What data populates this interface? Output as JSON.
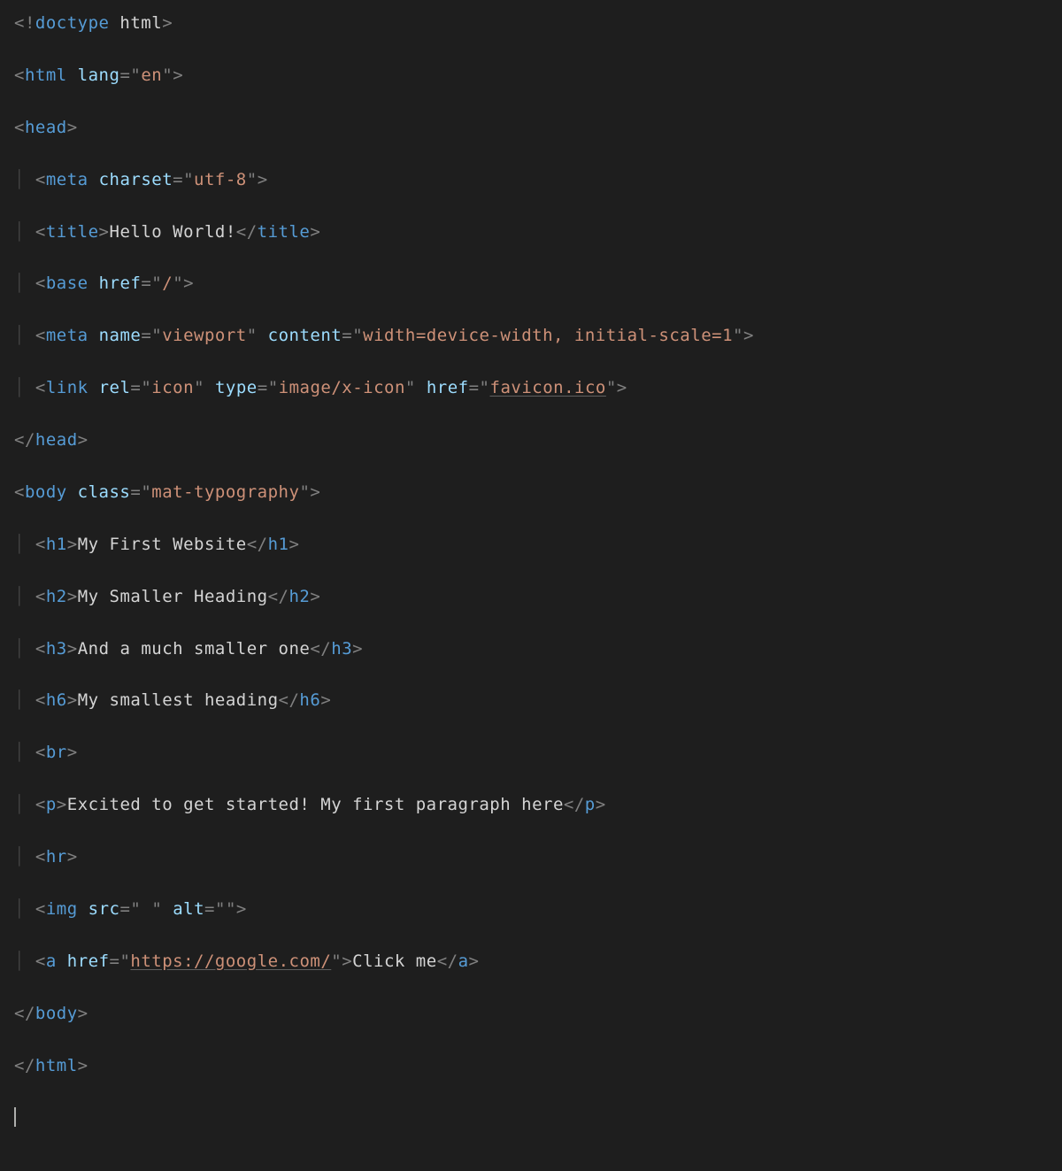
{
  "lines": [
    {
      "indent": 0,
      "type": "doctype",
      "tag": "doctype",
      "content_after": "html"
    },
    {
      "indent": 0,
      "type": "open",
      "tag": "html",
      "attrs": [
        {
          "name": "lang",
          "value": "en"
        }
      ]
    },
    {
      "indent": 0,
      "type": "open",
      "tag": "head"
    },
    {
      "indent": 1,
      "type": "void",
      "tag": "meta",
      "attrs": [
        {
          "name": "charset",
          "value": "utf-8"
        }
      ]
    },
    {
      "indent": 1,
      "type": "pair",
      "tag": "title",
      "text": "Hello World!"
    },
    {
      "indent": 1,
      "type": "void",
      "tag": "base",
      "attrs": [
        {
          "name": "href",
          "value": "/"
        }
      ]
    },
    {
      "indent": 1,
      "type": "void",
      "tag": "meta",
      "attrs": [
        {
          "name": "name",
          "value": "viewport"
        },
        {
          "name": "content",
          "value": "width=device-width, initial-scale=1"
        }
      ]
    },
    {
      "indent": 1,
      "type": "void",
      "tag": "link",
      "attrs": [
        {
          "name": "rel",
          "value": "icon"
        },
        {
          "name": "type",
          "value": "image/x-icon"
        },
        {
          "name": "href",
          "value": "favicon.ico",
          "underline": true
        }
      ]
    },
    {
      "indent": 0,
      "type": "close",
      "tag": "head"
    },
    {
      "indent": 0,
      "type": "open",
      "tag": "body",
      "attrs": [
        {
          "name": "class",
          "value": "mat-typography"
        }
      ]
    },
    {
      "indent": 1,
      "type": "pair",
      "tag": "h1",
      "text": "My First Website"
    },
    {
      "indent": 1,
      "type": "pair",
      "tag": "h2",
      "text": "My Smaller Heading"
    },
    {
      "indent": 1,
      "type": "pair",
      "tag": "h3",
      "text": "And a much smaller one"
    },
    {
      "indent": 1,
      "type": "pair",
      "tag": "h6",
      "text": "My smallest heading"
    },
    {
      "indent": 1,
      "type": "void",
      "tag": "br"
    },
    {
      "indent": 1,
      "type": "pair",
      "tag": "p",
      "text": "Excited to get started! My first paragraph here"
    },
    {
      "indent": 1,
      "type": "void",
      "tag": "hr"
    },
    {
      "indent": 1,
      "type": "void",
      "tag": "img",
      "attrs": [
        {
          "name": "src",
          "value": " "
        },
        {
          "name": "alt",
          "value": ""
        }
      ]
    },
    {
      "indent": 1,
      "type": "pair",
      "tag": "a",
      "attrs": [
        {
          "name": "href",
          "value": "https://google.com/",
          "underline": true
        }
      ],
      "text": "Click me"
    },
    {
      "indent": 0,
      "type": "close",
      "tag": "body"
    },
    {
      "indent": 0,
      "type": "close",
      "tag": "html"
    },
    {
      "indent": 0,
      "type": "cursor"
    }
  ]
}
